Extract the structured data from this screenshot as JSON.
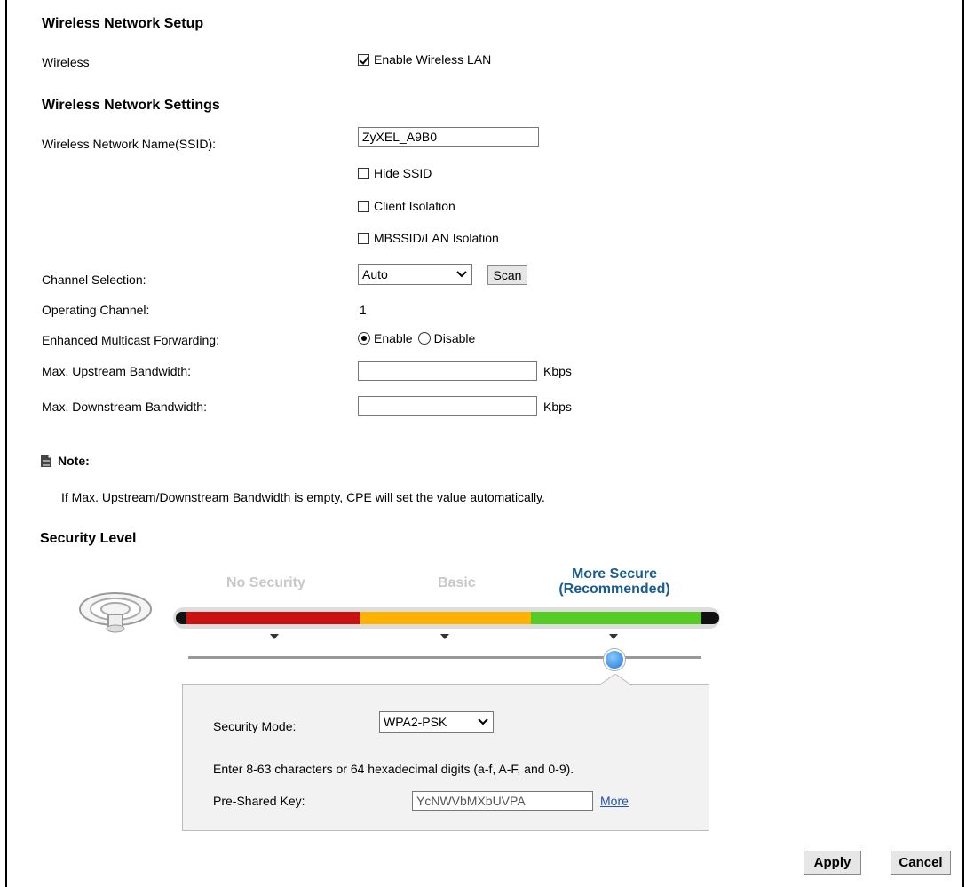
{
  "setup": {
    "title": "Wireless Network Setup",
    "wireless_label": "Wireless",
    "enable_label": "Enable Wireless LAN",
    "enable_checked": true
  },
  "settings": {
    "title": "Wireless Network Settings",
    "ssid_label": "Wireless Network Name(SSID):",
    "ssid_value": "ZyXEL_A9B0",
    "hide_ssid_label": "Hide SSID",
    "client_isolation_label": "Client Isolation",
    "mbssid_label": "MBSSID/LAN Isolation",
    "channel_label": "Channel Selection:",
    "channel_value": "Auto",
    "scan_label": "Scan",
    "operating_label": "Operating Channel:",
    "operating_value": "1",
    "emf_label": "Enhanced Multicast Forwarding:",
    "emf_enable": "Enable",
    "emf_disable": "Disable",
    "upstream_label": "Max. Upstream Bandwidth:",
    "upstream_value": "",
    "downstream_label": "Max. Downstream Bandwidth:",
    "downstream_value": "",
    "unit": "Kbps"
  },
  "note": {
    "title": "Note:",
    "text": "If Max. Upstream/Downstream Bandwidth is empty, CPE will set the value automatically."
  },
  "security": {
    "title": "Security Level",
    "levels": [
      "No Security",
      "Basic",
      "More Secure",
      "(Recommended)"
    ],
    "selected_level": "More Secure",
    "colors": {
      "red": "#cc1111",
      "orange": "#ffb300",
      "green": "#55cc22",
      "active_text": "#1a5c8f",
      "inactive_text": "#c8c8c8"
    },
    "mode_label": "Security Mode:",
    "mode_value": "WPA2-PSK",
    "hint": "Enter 8-63 characters or 64 hexadecimal digits (a-f, A-F, and 0-9).",
    "psk_label": "Pre-Shared Key:",
    "psk_value": "YcNWVbMXbUVPA",
    "more_link": "More"
  },
  "actions": {
    "apply": "Apply",
    "cancel": "Cancel"
  }
}
